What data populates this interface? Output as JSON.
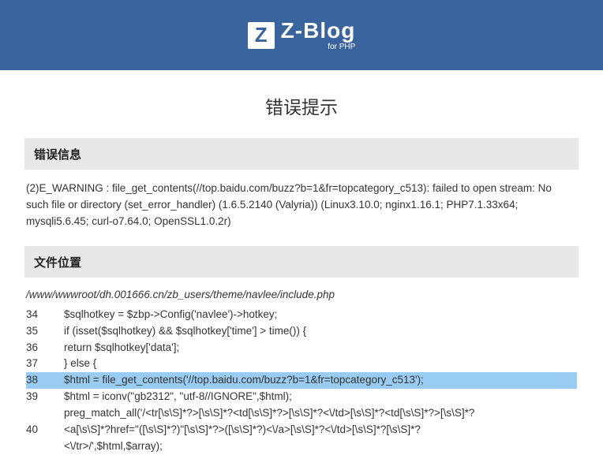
{
  "logo": {
    "z": "Z",
    "main": "Z-Blog",
    "sub": "for PHP"
  },
  "page_title": "错误提示",
  "error_info": {
    "heading": "错误信息",
    "message": "(2)E_WARNING : file_get_contents(//top.baidu.com/buzz?b=1&fr=topcategory_c513): failed to open stream: No such file or directory (set_error_handler) (1.6.5.2140 (Valyria)) (Linux3.10.0; nginx1.16.1; PHP7.1.33x64; mysqli5.6.45; curl-o7.64.0; OpenSSL1.0.2r)"
  },
  "file_loc": {
    "heading": "文件位置",
    "path": "/www/wwwroot/dh.001666.cn/zb_users/theme/navlee/include.php",
    "lines": [
      {
        "n": "34",
        "c": "$sqlhotkey = $zbp->Config('navlee')->hotkey;",
        "hl": false
      },
      {
        "n": "35",
        "c": "if (isset($sqlhotkey) && $sqlhotkey['time'] > time()) {",
        "hl": false
      },
      {
        "n": "36",
        "c": "return $sqlhotkey['data'];",
        "hl": false
      },
      {
        "n": "37",
        "c": "} else {",
        "hl": false
      },
      {
        "n": "38",
        "c": "$html = file_get_contents('//top.baidu.com/buzz?b=1&fr=topcategory_c513');",
        "hl": true
      },
      {
        "n": "39",
        "c": "$html = iconv(\"gb2312\", \"utf-8//IGNORE\",$html);",
        "hl": false
      },
      {
        "n": "",
        "c": "preg_match_all('/<tr[\\s\\S]*?>[\\s\\S]*?<td[\\s\\S]*?>[\\s\\S]*?<\\/td>[\\s\\S]*?<td[\\s\\S]*?>[\\s\\S]*?",
        "hl": false
      },
      {
        "n": "40",
        "c": "<a[\\s\\S]*?href=\"([\\s\\S]*?)\"[\\s\\S]*?>([\\s\\S]*?)<\\/a>[\\s\\S]*?<\\/td>[\\s\\S]*?[\\s\\S]*?",
        "hl": false
      },
      {
        "n": "",
        "c": "<\\/tr>/',$html,$array);",
        "hl": false
      }
    ]
  }
}
